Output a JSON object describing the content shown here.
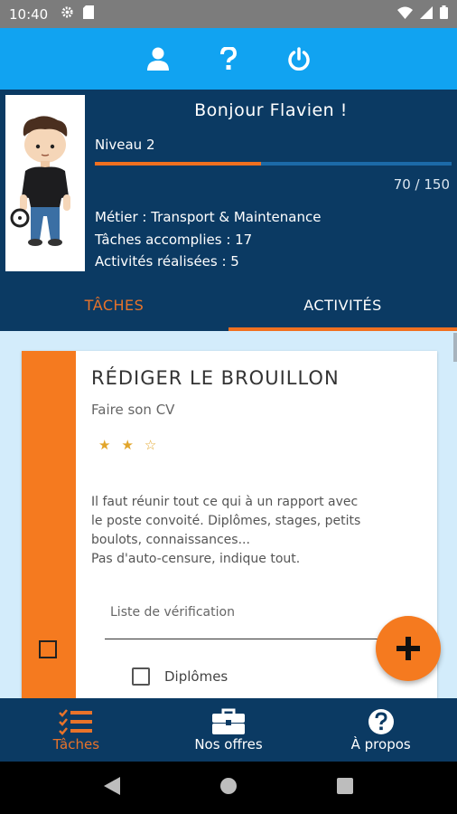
{
  "status_bar": {
    "time": "10:40"
  },
  "profile": {
    "greeting": "Bonjour Flavien !",
    "level": "Niveau 2",
    "progress": 0.4667,
    "xp": "70 / 150",
    "job": "Métier : Transport & Maintenance",
    "tasks_done": "Tâches accomplies : 17",
    "activities_done": "Activités réalisées : 5"
  },
  "tabs": [
    {
      "label": "TÂCHES",
      "selected": false
    },
    {
      "label": "ACTIVITÉS",
      "selected": true
    }
  ],
  "card": {
    "title": "RÉDIGER LE BROUILLON",
    "subtitle": "Faire son CV",
    "rating": 2,
    "rating_max": 3,
    "description_lines": [
      "Il faut réunir tout ce qui à un rapport avec",
      "le poste convoité. Diplômes, stages, petits",
      "boulots, connaissances...",
      "Pas d'auto-censure, indique tout."
    ],
    "checklist_label": "Liste de vérification",
    "checklist_items": [
      {
        "label": "Diplômes",
        "checked": false
      }
    ],
    "done": false
  },
  "bottom_nav": [
    {
      "label": "Tâches",
      "icon": "tasks-icon",
      "active": true
    },
    {
      "label": "Nos offres",
      "icon": "briefcase-icon",
      "active": false
    },
    {
      "label": "À propos",
      "icon": "help-circle-icon",
      "active": false
    }
  ],
  "colors": {
    "primary": "#0b3a63",
    "accent": "#f57a1f",
    "top_bar": "#11a3f1"
  }
}
